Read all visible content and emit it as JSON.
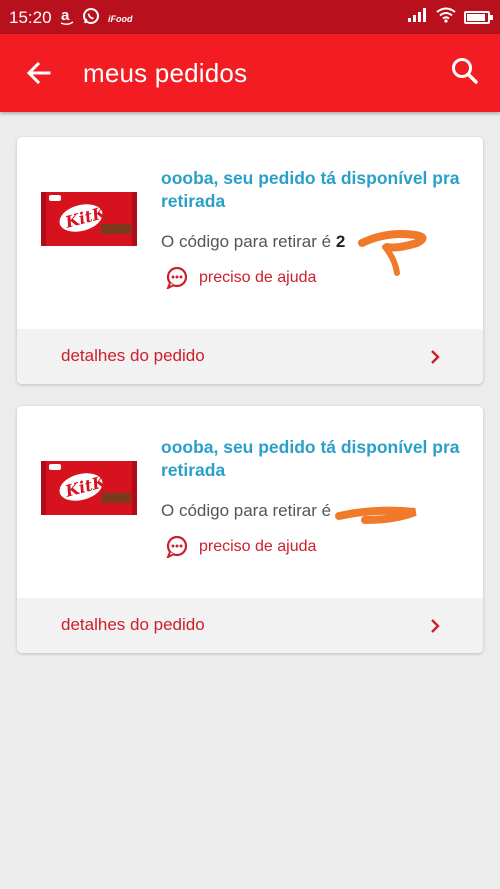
{
  "status_bar": {
    "time": "15:20",
    "notification_icons": [
      "amazon-icon",
      "whatsapp-icon",
      "ifood-icon"
    ],
    "ifood_text": "iFood"
  },
  "app_bar": {
    "title": "meus pedidos",
    "back_icon": "arrow-left-icon",
    "search_icon": "search-icon"
  },
  "orders": [
    {
      "headline": "oooba, seu pedido tá disponível pra retirada",
      "code_label": "O código para retirar é",
      "code_visible": "2",
      "help_label": "preciso de ajuda",
      "details_label": "detalhes do pedido",
      "product": "KitKat"
    },
    {
      "headline": "oooba, seu pedido tá disponível pra retirada",
      "code_label": "O código para retirar é",
      "code_visible": "",
      "help_label": "preciso de ajuda",
      "details_label": "detalhes do pedido",
      "product": "KitKat"
    }
  ],
  "colors": {
    "status_bar": "#b8101d",
    "app_bar": "#f31c23",
    "headline": "#2aa0c9",
    "accent_red": "#cc1f2b",
    "background": "#ececec",
    "redaction": "#f0792a"
  }
}
